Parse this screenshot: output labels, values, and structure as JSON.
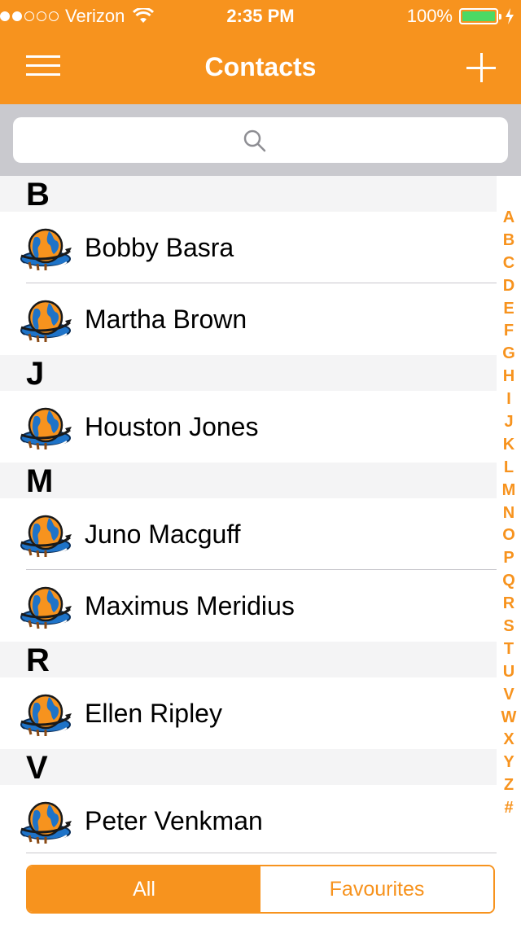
{
  "status_bar": {
    "signal_filled": 2,
    "signal_total": 5,
    "carrier": "Verizon",
    "time": "2:35 PM",
    "battery": "100%",
    "battery_color": "#4cd964"
  },
  "nav": {
    "title": "Contacts",
    "menu_icon": "hamburger-menu-icon",
    "add_icon": "plus-icon",
    "color": "#f7931e"
  },
  "search": {
    "placeholder": "",
    "icon": "search-icon"
  },
  "sections": [
    {
      "letter": "B",
      "contacts": [
        "Bobby Basra",
        "Martha Brown"
      ]
    },
    {
      "letter": "J",
      "contacts": [
        "Houston Jones"
      ]
    },
    {
      "letter": "M",
      "contacts": [
        "Juno Macguff",
        "Maximus Meridius"
      ]
    },
    {
      "letter": "R",
      "contacts": [
        "Ellen Ripley"
      ]
    },
    {
      "letter": "V",
      "contacts": [
        "Peter Venkman"
      ]
    }
  ],
  "index_letters": [
    "A",
    "B",
    "C",
    "D",
    "E",
    "F",
    "G",
    "H",
    "I",
    "J",
    "K",
    "L",
    "M",
    "N",
    "O",
    "P",
    "Q",
    "R",
    "S",
    "T",
    "U",
    "V",
    "W",
    "X",
    "Y",
    "Z",
    "#"
  ],
  "segments": {
    "all": "All",
    "favourites": "Favourites",
    "selected": "All"
  }
}
